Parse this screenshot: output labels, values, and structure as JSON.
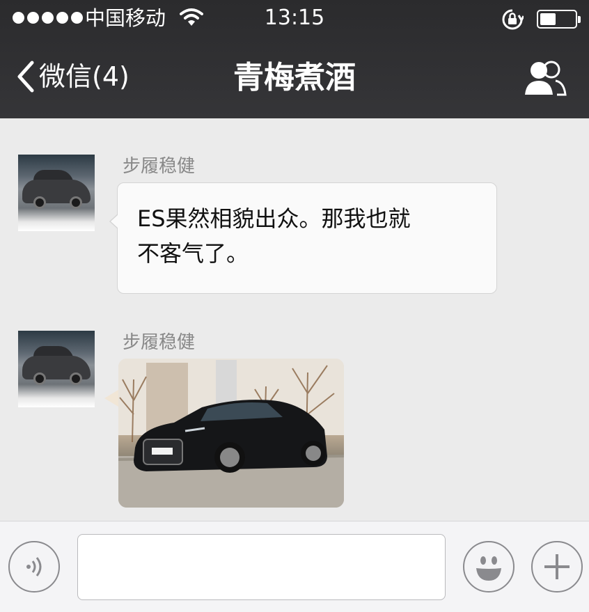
{
  "status_bar": {
    "carrier": "中国移动",
    "time": "13:15",
    "battery_level": 0.45
  },
  "nav": {
    "back_label": "微信(4)",
    "title": "青梅煮酒"
  },
  "messages": [
    {
      "sender": "步履稳健",
      "type": "text",
      "text_line1": "ES果然相貌出众。那我也就",
      "text_line2": "不客气了。"
    },
    {
      "sender": "步履稳健",
      "type": "image"
    }
  ],
  "input": {
    "value": ""
  },
  "icons": {
    "back": "chevron-left-icon",
    "members": "group-members-icon",
    "voice": "voice-icon",
    "emoji": "emoji-icon",
    "more": "plus-icon",
    "wifi": "wifi-icon",
    "rotation_lock": "rotation-lock-icon",
    "battery": "battery-icon"
  },
  "colors": {
    "nav_bg": "#2f2f31",
    "chat_bg": "#ebebeb",
    "bubble_bg": "#fafafa",
    "sender_text": "#888888"
  }
}
